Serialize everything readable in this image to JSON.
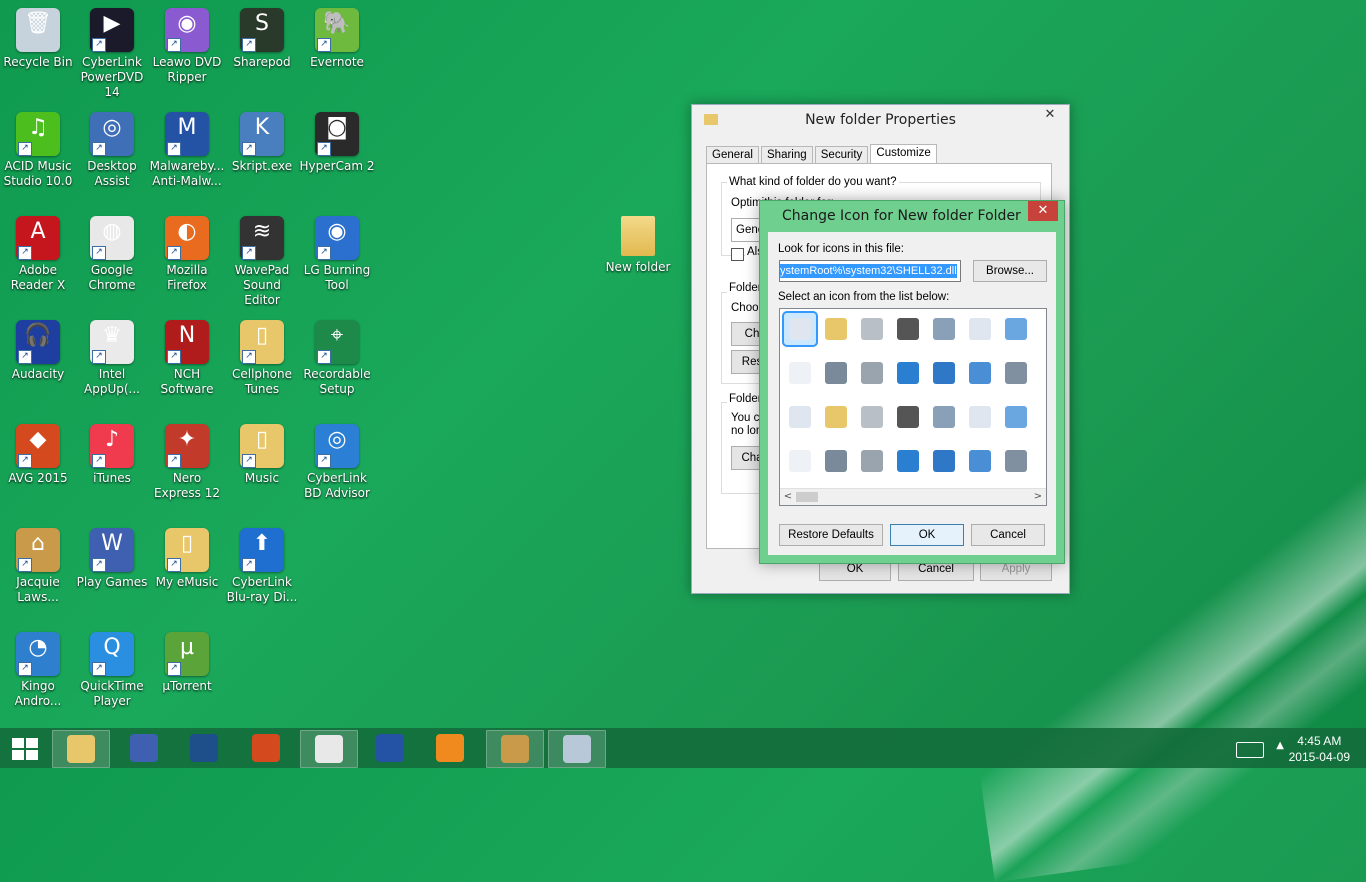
{
  "desktop": {
    "icons": [
      {
        "label": "Recycle Bin",
        "color": "#c7d3dc",
        "glyph": "🗑"
      },
      {
        "label": "CyberLink PowerDVD 14",
        "color": "#1a1a2a",
        "glyph": "▶"
      },
      {
        "label": "Leawo DVD Ripper",
        "color": "#8a5bd0",
        "glyph": "◉"
      },
      {
        "label": "Sharepod",
        "color": "#2a3a2a",
        "glyph": "S"
      },
      {
        "label": "Evernote",
        "color": "#6dba3f",
        "glyph": "🐘"
      },
      {
        "label": "ACID Music Studio 10.0",
        "color": "#4cbf1f",
        "glyph": "♫"
      },
      {
        "label": "Desktop Assist",
        "color": "#3f6fb6",
        "glyph": "◎"
      },
      {
        "label": "Malwareby... Anti-Malw...",
        "color": "#2453a6",
        "glyph": "M"
      },
      {
        "label": "Skript.exe",
        "color": "#4a7fbf",
        "glyph": "K"
      },
      {
        "label": "HyperCam 2",
        "color": "#2a2a2a",
        "glyph": "◙"
      },
      {
        "label": "Adobe Reader X",
        "color": "#c4161c",
        "glyph": "A"
      },
      {
        "label": "Google Chrome",
        "color": "#e8e8e8",
        "glyph": "◍"
      },
      {
        "label": "Mozilla Firefox",
        "color": "#e86b1f",
        "glyph": "◐"
      },
      {
        "label": "WavePad Sound Editor",
        "color": "#333333",
        "glyph": "≋"
      },
      {
        "label": "LG Burning Tool",
        "color": "#2b6fcf",
        "glyph": "◉"
      },
      {
        "label": "Audacity",
        "color": "#1e3fa0",
        "glyph": "🎧"
      },
      {
        "label": "Intel AppUp(...",
        "color": "#eaeaea",
        "glyph": "♛"
      },
      {
        "label": "NCH Software",
        "color": "#b01c1c",
        "glyph": "N"
      },
      {
        "label": "Cellphone Tunes",
        "color": "#e8c66a",
        "glyph": "▯"
      },
      {
        "label": "Recordable Setup",
        "color": "#1e8a4a",
        "glyph": "⌖"
      },
      {
        "label": "AVG 2015",
        "color": "#d44a1e",
        "glyph": "◆"
      },
      {
        "label": "iTunes",
        "color": "#f03a4d",
        "glyph": "♪"
      },
      {
        "label": "Nero Express 12",
        "color": "#c23a2a",
        "glyph": "✦"
      },
      {
        "label": "Music",
        "color": "#e8c66a",
        "glyph": "▯"
      },
      {
        "label": "CyberLink BD Advisor",
        "color": "#2b7fd4",
        "glyph": "◎"
      },
      {
        "label": "Jacquie Laws...",
        "color": "#c89a4a",
        "glyph": "⌂"
      },
      {
        "label": "Play Games",
        "color": "#3f5fb0",
        "glyph": "W"
      },
      {
        "label": "My eMusic",
        "color": "#e8c66a",
        "glyph": "▯"
      },
      {
        "label": "CyberLink Blu-ray Di...",
        "color": "#1f6fd0",
        "glyph": "⬆"
      },
      {
        "label": "Kingo Andro...",
        "color": "#2f7fcf",
        "glyph": "◔"
      },
      {
        "label": "QuickTime Player",
        "color": "#2a8fe0",
        "glyph": "Q"
      },
      {
        "label": "µTorrent",
        "color": "#5aa43a",
        "glyph": "µ"
      }
    ],
    "new_folder_label": "New folder"
  },
  "properties": {
    "title": "New folder Properties",
    "close": "✕",
    "tabs": [
      "General",
      "Sharing",
      "Security",
      "Customize"
    ],
    "active_tab": "Customize",
    "q1": "What kind of folder do you want?",
    "optimize_label": "Optimi",
    "optimize_tail": "this folder for:",
    "dropdown_value": "Gene",
    "checkbox_label": "Als",
    "folder_pictures": "Folder",
    "choose_label": "Choos",
    "choose_btn": "Ch",
    "restore_btn": "Res",
    "folder_icons": "Folder",
    "you_can": "You ca",
    "no_lon": "no lon",
    "change_btn": "Cha",
    "ok": "OK",
    "cancel": "Cancel",
    "apply": "Apply"
  },
  "change_icon": {
    "title": "Change Icon for New folder Folder",
    "close": "✕",
    "look_label": "Look for icons in this file:",
    "path_value": "ystemRoot%\\system32\\SHELL32.dll",
    "browse": "Browse...",
    "select_label": "Select an icon from the list below:",
    "restore_defaults": "Restore Defaults",
    "ok": "OK",
    "cancel": "Cancel",
    "scroll_left": "<",
    "scroll_right": ">",
    "grid_icons": [
      [
        "blank-document-icon",
        "folder-icon",
        "drive-icon",
        "memory-chip-icon",
        "printer-icon",
        "clock-document-icon",
        "window-app-icon"
      ],
      [
        "text-document-icon",
        "network-drive-icon",
        "server-icon",
        "globe-icon",
        "network-globe-icon",
        "monitor-desktop-icon",
        "device-icon"
      ],
      [
        "window-icon",
        "floppy-icon",
        "drive-x-icon",
        "globe-mouse-icon",
        "network-icon",
        "search-icon",
        "back-arrow-icon"
      ],
      [
        "folder-icon",
        "flat-drive-icon",
        "cd-drive-icon",
        "computer-icon",
        "calculator-icon",
        "help-icon",
        "power-icon"
      ]
    ]
  },
  "taskbar": {
    "start": "start-icon",
    "items": [
      "file-explorer",
      "webshots-w",
      "media-player",
      "avg",
      "chrome",
      "malwarebytes",
      "player",
      "bank",
      "paint"
    ],
    "time": "4:45 AM",
    "date": "2015-04-09",
    "up_arrow": "▲"
  }
}
